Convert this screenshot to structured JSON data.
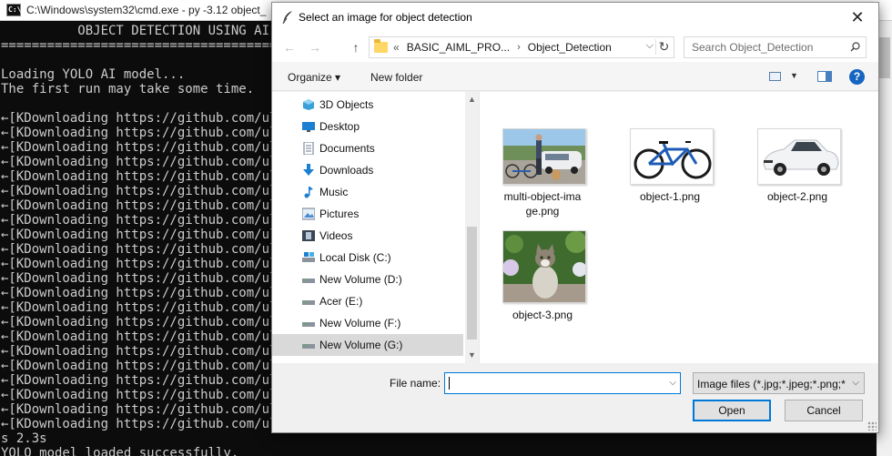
{
  "console": {
    "title": "C:\\Windows\\system32\\cmd.exe - py  -3.12 object_",
    "lines": [
      "          OBJECT DETECTION USING AI",
      "========================================",
      "",
      "Loading YOLO AI model...",
      "The first run may take some time.",
      "",
      "←[KDownloading https://github.com/ultr",
      "←[KDownloading https://github.com/ultr",
      "←[KDownloading https://github.com/ultr",
      "←[KDownloading https://github.com/ultr",
      "←[KDownloading https://github.com/ultr",
      "←[KDownloading https://github.com/ultr",
      "←[KDownloading https://github.com/ultr",
      "←[KDownloading https://github.com/ultr",
      "←[KDownloading https://github.com/ultr",
      "←[KDownloading https://github.com/ultr",
      "←[KDownloading https://github.com/ultr",
      "←[KDownloading https://github.com/ultr",
      "←[KDownloading https://github.com/ultr",
      "←[KDownloading https://github.com/ultr",
      "←[KDownloading https://github.com/ultr",
      "←[KDownloading https://github.com/ultr",
      "←[KDownloading https://github.com/ultr",
      "←[KDownloading https://github.com/ultr",
      "←[KDownloading https://github.com/ultr",
      "←[KDownloading https://github.com/ultr",
      "←[KDownloading https://github.com/ultr",
      "←[KDownloading https://github.com/ultr",
      "s 2.3s",
      "YOLO model loaded successfully."
    ]
  },
  "dialog": {
    "title": "Select an image for object detection",
    "close_glyph": "✕",
    "nav": {
      "back": "←",
      "forward": "→",
      "up": "↑"
    },
    "address": {
      "overflow": "«",
      "crumbs": [
        "BASIC_AIML_PRO...",
        "Object_Detection"
      ],
      "sep": "›",
      "dropdown": "⌵",
      "refresh": "↻"
    },
    "search_placeholder": "Search Object_Detection",
    "toolbar": {
      "organize": "Organize ▾",
      "new_folder": "New folder",
      "view_dd": "▼",
      "help": "?"
    },
    "nav_items": [
      {
        "label": "3D Objects",
        "icon": "cube-icon",
        "selected": false
      },
      {
        "label": "Desktop",
        "icon": "desktop-icon",
        "selected": false
      },
      {
        "label": "Documents",
        "icon": "documents-icon",
        "selected": false
      },
      {
        "label": "Downloads",
        "icon": "download-arrow-icon",
        "selected": false
      },
      {
        "label": "Music",
        "icon": "music-note-icon",
        "selected": false
      },
      {
        "label": "Pictures",
        "icon": "pictures-icon",
        "selected": false
      },
      {
        "label": "Videos",
        "icon": "film-icon",
        "selected": false
      },
      {
        "label": "Local Disk (C:)",
        "icon": "system-drive-icon",
        "selected": false
      },
      {
        "label": "New Volume (D:)",
        "icon": "drive-icon",
        "selected": false
      },
      {
        "label": "Acer (E:)",
        "icon": "drive-icon",
        "selected": false
      },
      {
        "label": "New Volume (F:)",
        "icon": "drive-icon",
        "selected": false
      },
      {
        "label": "New Volume (G:)",
        "icon": "drive-icon",
        "selected": true
      }
    ],
    "files": [
      {
        "name_line1": "multi-object-ima",
        "name_line2": "ge.png",
        "thumb": "multi-object-thumbnail"
      },
      {
        "name_line1": "object-1.png",
        "name_line2": "",
        "thumb": "bicycle-thumbnail"
      },
      {
        "name_line1": "object-2.png",
        "name_line2": "",
        "thumb": "car-thumbnail"
      },
      {
        "name_line1": "object-3.png",
        "name_line2": "",
        "thumb": "cat-thumbnail"
      }
    ],
    "file_name_label": "File name:",
    "file_name_value": "",
    "file_type": "Image files (*.jpg;*.jpeg;*.png;*",
    "open_label": "Open",
    "cancel_label": "Cancel",
    "colors": {
      "accent": "#0078d7",
      "folder": "#ffd766",
      "help": "#1665c1"
    }
  }
}
